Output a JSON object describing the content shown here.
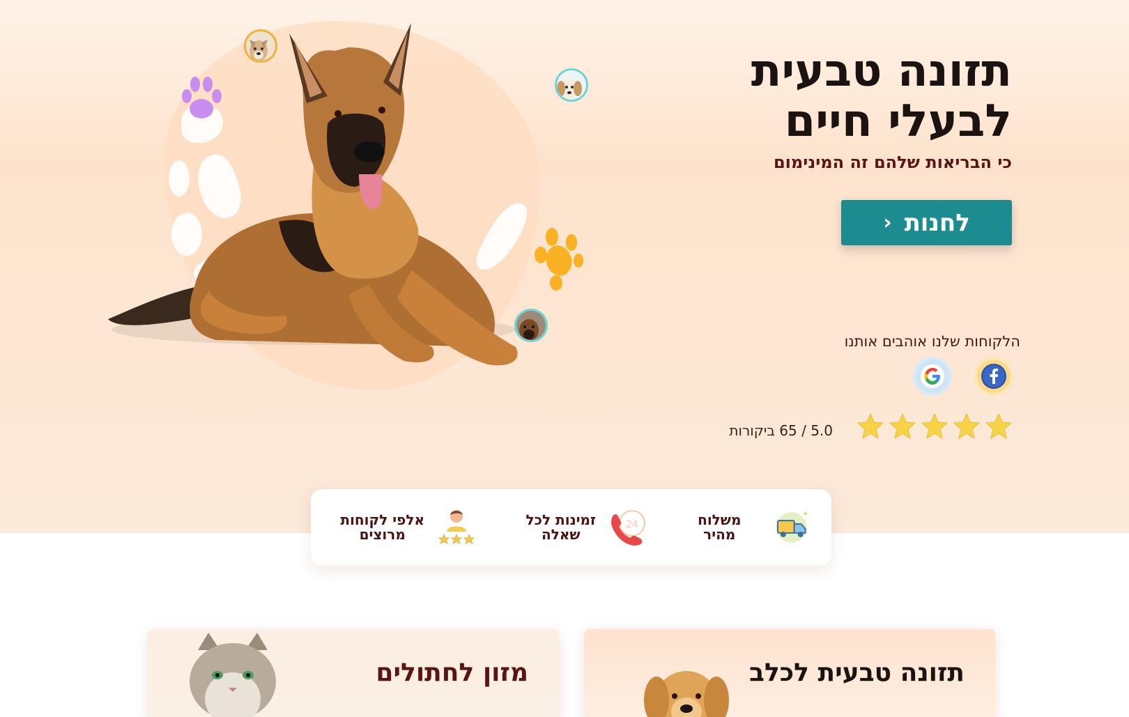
{
  "hero": {
    "title_line1": "תזונה טבעית",
    "title_line2": "לבעלי חיים",
    "subtitle": "כי הבריאות שלהם זה המינימום",
    "shop_button": "לחנות"
  },
  "reviews": {
    "title": "הלקוחות שלנו אוהבים אותנו",
    "rating_text": "5.0 / 65 ביקורות",
    "stars": 5,
    "sources": [
      "facebook-icon",
      "google-icon"
    ]
  },
  "features": [
    {
      "label": "משלוח מהיר",
      "icon": "delivery-truck-icon"
    },
    {
      "label_line1": "זמינות לכל",
      "label_line2": "שאלה",
      "icon": "phone-24-icon"
    },
    {
      "label_line1": "אלפי לקוחות",
      "label_line2": "מרוצים",
      "icon": "happy-customer-icon"
    }
  ],
  "categories": {
    "dog_title": "תזונה טבעית לכלב",
    "cat_title": "מזון לחתולים"
  },
  "colors": {
    "accent": "#1c8c91",
    "heading_dark": "#1b1212",
    "heading_maroon": "#5a1414",
    "star": "#f8d347",
    "paw_purple": "#c98df0",
    "paw_orange": "#fbb124"
  }
}
